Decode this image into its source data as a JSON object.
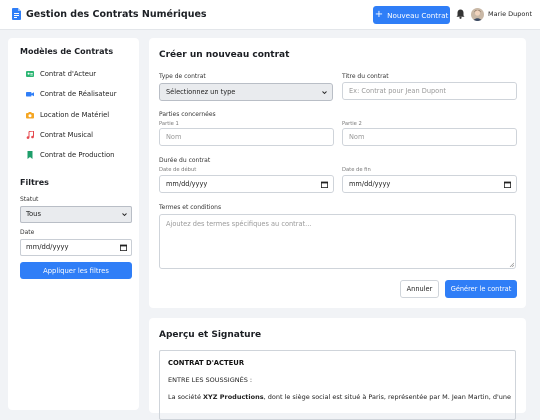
{
  "header": {
    "app_title": "Gestion des Contrats Numériques",
    "new_button": "Nouveau Contrat",
    "user_name": "Marie Dupont"
  },
  "sidebar": {
    "templates_title": "Modèles de Contrats",
    "templates": [
      {
        "label": "Contrat d'Acteur",
        "icon": "actor-card-icon",
        "color": "#2bb673"
      },
      {
        "label": "Contrat de Réalisateur",
        "icon": "video-camera-icon",
        "color": "#2f7ef7"
      },
      {
        "label": "Location de Matériel",
        "icon": "camera-icon",
        "color": "#f5a623"
      },
      {
        "label": "Contrat Musical",
        "icon": "music-note-icon",
        "color": "#e5484d"
      },
      {
        "label": "Contrat de Production",
        "icon": "bookmark-icon",
        "color": "#1e9e6a"
      }
    ],
    "filters_title": "Filtres",
    "status_label": "Statut",
    "status_value": "Tous",
    "date_label": "Date",
    "date_placeholder": "mm/dd/yyyy",
    "apply_button": "Appliquer les filtres"
  },
  "create": {
    "title": "Créer un nouveau contrat",
    "type_label": "Type de contrat",
    "type_value": "Sélectionnez un type",
    "contract_title_label": "Titre du contrat",
    "contract_title_placeholder": "Ex: Contrat pour Jean Dupont",
    "parties_label": "Parties concernées",
    "party1_label": "Partie 1",
    "party1_placeholder": "Nom",
    "party2_label": "Partie 2",
    "party2_placeholder": "Nom",
    "duration_label": "Durée du contrat",
    "start_label": "Date de début",
    "start_placeholder": "mm/dd/yyyy",
    "end_label": "Date de fin",
    "end_placeholder": "mm/dd/yyyy",
    "terms_label": "Termes et conditions",
    "terms_placeholder": "Ajoutez des termes spécifiques au contrat...",
    "cancel_button": "Annuler",
    "generate_button": "Générer le contrat"
  },
  "preview": {
    "title": "Aperçu et Signature",
    "doc_title": "CONTRAT D'ACTEUR",
    "line1": "ENTRE LES SOUSSIGNÉS :",
    "line2_prefix": "La société ",
    "line2_company": "XYZ Productions",
    "line2_suffix": ", dont le siège social est situé à Paris, représentée par M. Jean Martin, d'une"
  },
  "colors": {
    "accent": "#2f7ef7",
    "background": "#f1f3f6"
  }
}
